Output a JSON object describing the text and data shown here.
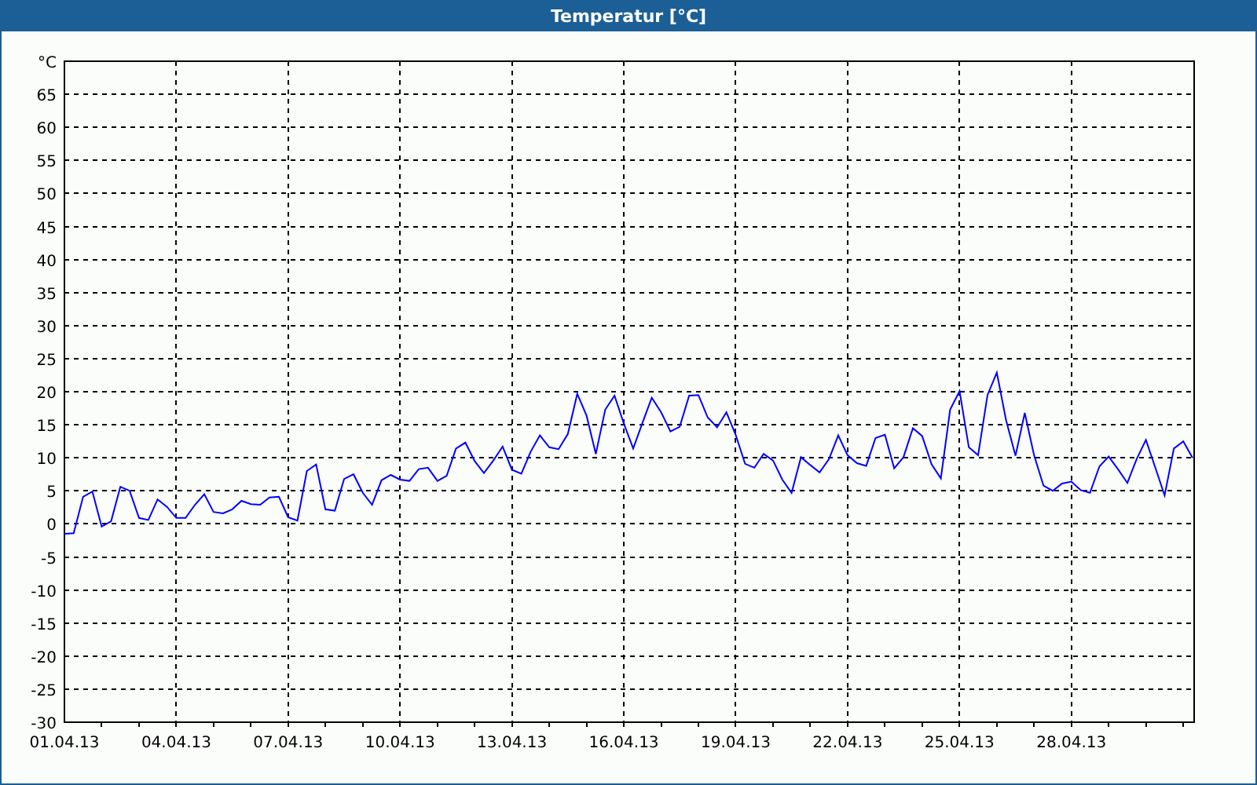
{
  "window": {
    "title": "Temperatur [°C]"
  },
  "chart": {
    "chart_data": {
      "type": "line",
      "grid": true,
      "ylim": [
        -30,
        70
      ],
      "yticks": [
        -30,
        -25,
        -20,
        -15,
        -10,
        -5,
        0,
        5,
        10,
        15,
        20,
        25,
        30,
        35,
        40,
        45,
        50,
        55,
        60,
        65,
        {
          "value": 70,
          "label": "°C"
        }
      ],
      "categories": [
        "01.04.13",
        null,
        null,
        null,
        null,
        null,
        null,
        null,
        null,
        null,
        null,
        null,
        "04.04.13",
        null,
        null,
        null,
        null,
        null,
        null,
        null,
        null,
        null,
        null,
        null,
        "07.04.13",
        null,
        null,
        null,
        null,
        null,
        null,
        null,
        null,
        null,
        null,
        null,
        "10.04.13",
        null,
        null,
        null,
        null,
        null,
        null,
        null,
        null,
        null,
        null,
        null,
        "13.04.13",
        null,
        null,
        null,
        null,
        null,
        null,
        null,
        null,
        null,
        null,
        null,
        "16.04.13",
        null,
        null,
        null,
        null,
        null,
        null,
        null,
        null,
        null,
        null,
        null,
        "19.04.13",
        null,
        null,
        null,
        null,
        null,
        null,
        null,
        null,
        null,
        null,
        null,
        "22.04.13",
        null,
        null,
        null,
        null,
        null,
        null,
        null,
        null,
        null,
        null,
        null,
        "25.04.13",
        null,
        null,
        null,
        null,
        null,
        null,
        null,
        null,
        null,
        null,
        null,
        "28.04.13",
        null,
        null,
        null,
        null,
        null,
        null,
        null,
        null,
        null,
        null,
        null,
        null,
        null
      ],
      "series": [
        {
          "color": "#0000ff",
          "values": [
            -1.5,
            -1.4,
            4.1,
            4.9,
            -0.4,
            0.4,
            5.6,
            5,
            0.9,
            0.6,
            3.7,
            2.6,
            0.9,
            0.9,
            2.9,
            4.5,
            1.8,
            1.6,
            2.2,
            3.5,
            3,
            2.9,
            4,
            4.1,
            1,
            0.5,
            8,
            9,
            2.2,
            2,
            6.8,
            7.5,
            4.7,
            2.9,
            6.6,
            7.4,
            6.7,
            6.5,
            8.3,
            8.5,
            6.5,
            7.3,
            11.4,
            12.3,
            9.5,
            7.7,
            9.6,
            11.7,
            8.2,
            7.6,
            10.9,
            13.4,
            11.6,
            11.3,
            13.6,
            19.7,
            16.4,
            10.6,
            17.3,
            19.4,
            15.2,
            11.4,
            15.3,
            19.1,
            16.9,
            14,
            14.7,
            19.4,
            19.5,
            16.1,
            14.6,
            16.9,
            13.5,
            9.1,
            8.5,
            10.6,
            9.6,
            6.7,
            4.7,
            10.1,
            8.9,
            7.8,
            9.8,
            13.4,
            10.4,
            9.2,
            8.8,
            13,
            13.5,
            8.4,
            10.1,
            14.5,
            13.3,
            9,
            6.9,
            17.3,
            20.1,
            11.6,
            10.4,
            19.5,
            22.9,
            15.7,
            10.3,
            16.8,
            10.4,
            5.8,
            5,
            6.1,
            6.4,
            5.1,
            4.7,
            8.7,
            10.2,
            8.3,
            6.2,
            9.8,
            12.7,
            8.5,
            4.3,
            11.4,
            12.5,
            10
          ]
        }
      ]
    }
  }
}
